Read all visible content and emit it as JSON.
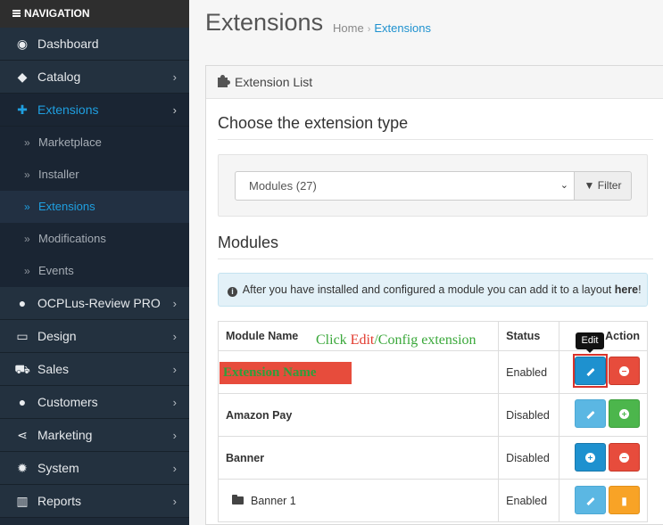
{
  "sidebar": {
    "nav_title": "NAVIGATION",
    "items": [
      {
        "label": "Dashboard",
        "icon": "dashboard-icon",
        "glyph": "◉"
      },
      {
        "label": "Catalog",
        "icon": "tags-icon",
        "glyph": "◆"
      },
      {
        "label": "Extensions",
        "icon": "puzzle-icon",
        "glyph": "✚"
      },
      {
        "label": "OCPLus-Review PRO",
        "icon": "comments-icon",
        "glyph": "●"
      },
      {
        "label": "Design",
        "icon": "monitor-icon",
        "glyph": "▭"
      },
      {
        "label": "Sales",
        "icon": "cart-icon",
        "glyph": "⛟"
      },
      {
        "label": "Customers",
        "icon": "user-icon",
        "glyph": "●"
      },
      {
        "label": "Marketing",
        "icon": "share-icon",
        "glyph": "⋖"
      },
      {
        "label": "System",
        "icon": "cog-icon",
        "glyph": "✹"
      },
      {
        "label": "Reports",
        "icon": "bar-chart-icon",
        "glyph": "▥"
      }
    ],
    "sub_items": [
      "Marketplace",
      "Installer",
      "Extensions",
      "Modifications",
      "Events"
    ],
    "chevron": "›",
    "double_chevron": "»"
  },
  "header": {
    "title": "Extensions",
    "breadcrumb": [
      "Home",
      "Extensions"
    ],
    "separator": "›"
  },
  "panel": {
    "heading": "Extension List",
    "choose_title": "Choose the extension type",
    "select_value": "Modules (27)",
    "filter_label": "Filter",
    "modules_title": "Modules",
    "alert": {
      "text_before": "After you have installed and configured a module you can add it to a layout ",
      "link": "here",
      "text_after": "!"
    },
    "table": {
      "headers": [
        "Module Name",
        "Status",
        "Action"
      ],
      "rows": [
        {
          "name": "",
          "status": "Enabled"
        },
        {
          "name": "Amazon Pay",
          "status": "Disabled"
        },
        {
          "name": "Banner",
          "status": "Disabled"
        },
        {
          "name": "Banner 1",
          "status": "Enabled"
        }
      ]
    }
  },
  "overlay": {
    "annotation_part1": "Click ",
    "annotation_part2": "Edit",
    "annotation_part3": "/Config extension",
    "ext_name": "Extension Name",
    "tooltip": "Edit"
  },
  "colors": {
    "sidebar_bg": "#1e2a38",
    "accent_blue": "#1e91cf",
    "danger_red": "#e74c3c",
    "success_green": "#4cb64c",
    "warning_orange": "#f8a326"
  }
}
